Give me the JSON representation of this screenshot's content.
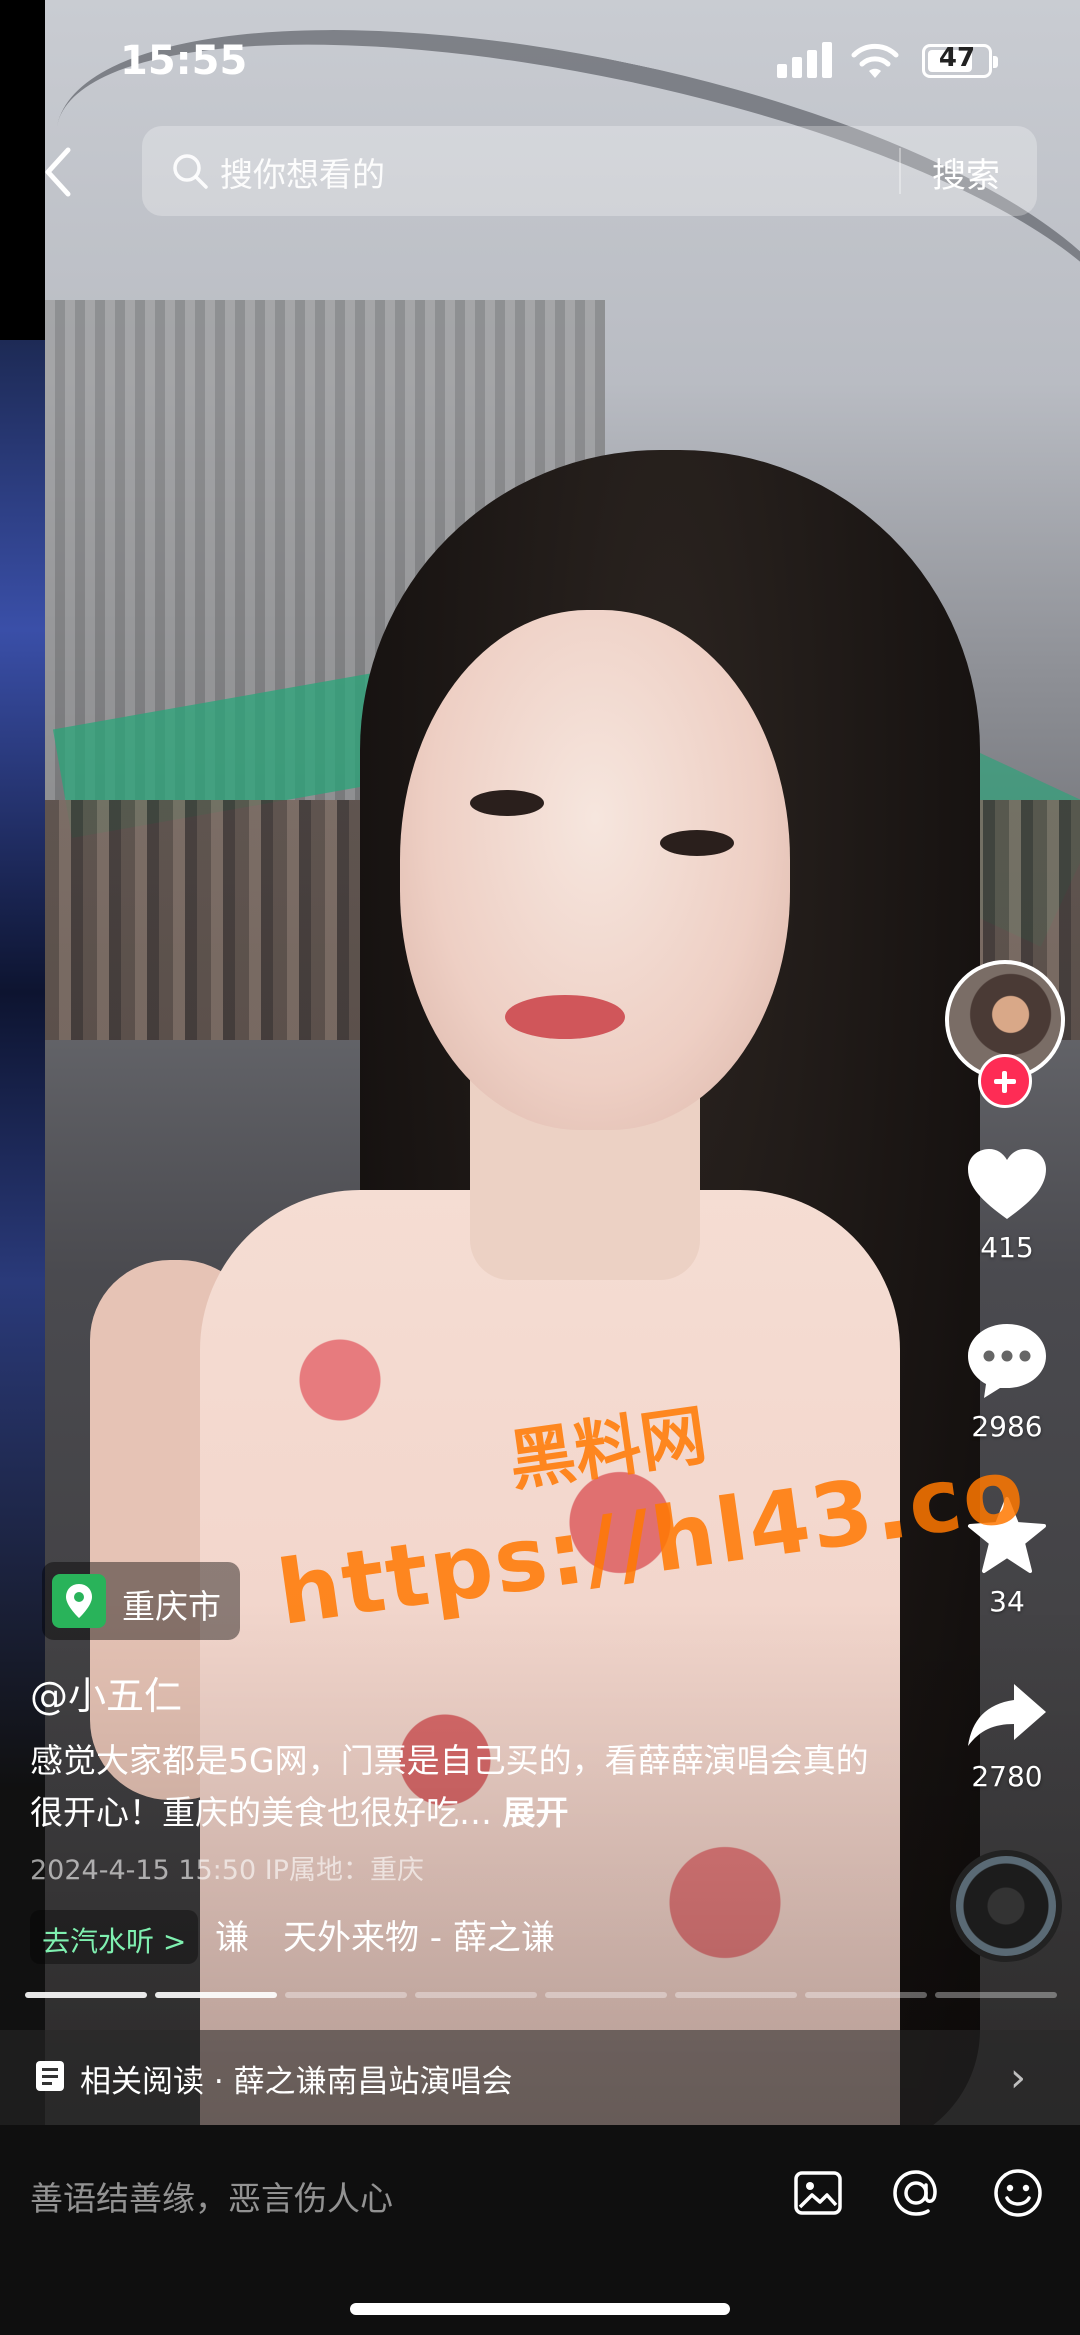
{
  "status_bar": {
    "time": "15:55",
    "battery": "47"
  },
  "search": {
    "placeholder": "搜你想看的",
    "button": "搜索"
  },
  "rail": {
    "likes": "415",
    "comments": "2986",
    "favorites": "34",
    "shares": "2780"
  },
  "location": "重庆市",
  "post": {
    "author": "@小五仁",
    "description": "感觉大家都是5G网，门票是自己买的，看薛薛演唱会真的很开心！重庆的美食也很好吃…",
    "more": "展开",
    "meta": "2024-4-15 15:50  IP属地：重庆"
  },
  "music": {
    "chip": "去汽水听 >",
    "title": "谦　天外来物 - 薛之谦"
  },
  "related": {
    "label": "相关阅读 · 薛之谦南昌站演唱会"
  },
  "comment_input": {
    "placeholder": "善语结善缘，恶言伤人心"
  },
  "watermark": {
    "line1": "黑料网",
    "line2": "https://hl43.co"
  },
  "colors": {
    "follow_badge": "#fe2c55",
    "location_pin": "#29b35a",
    "music_chip_text": "#7ff0b0",
    "watermark": "#ff7800"
  },
  "icons": [
    "back-icon",
    "search-icon",
    "heart-icon",
    "comment-icon",
    "star-icon",
    "share-icon",
    "document-icon",
    "image-icon",
    "at-icon",
    "emoji-icon",
    "location-pin-icon"
  ]
}
